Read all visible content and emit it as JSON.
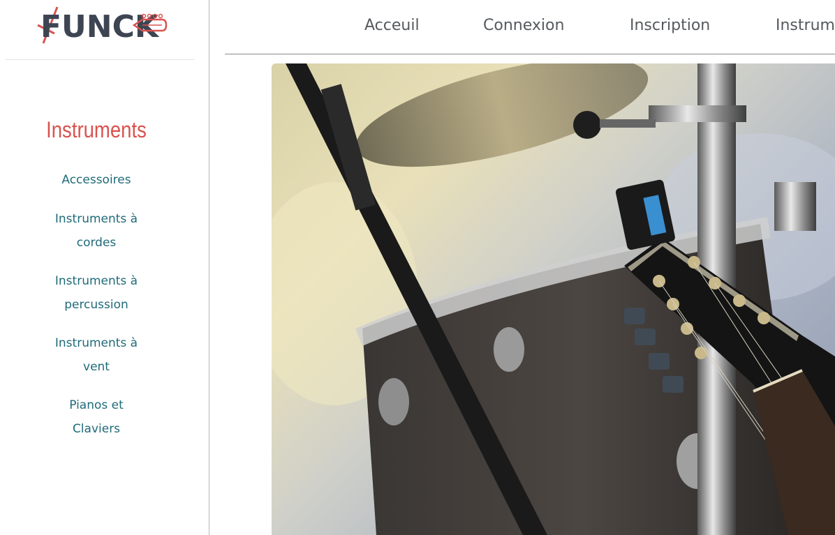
{
  "brand": {
    "logo_text": "FUNCK"
  },
  "sidebar": {
    "title": "Instruments",
    "items": [
      {
        "line1": "Accessoires",
        "line2": ""
      },
      {
        "line1": "Instruments à",
        "line2": "cordes"
      },
      {
        "line1": "Instruments à",
        "line2": "percussion"
      },
      {
        "line1": "Instruments à",
        "line2": "vent"
      },
      {
        "line1": "Pianos et",
        "line2": "Claviers"
      }
    ]
  },
  "nav": {
    "items": [
      "Acceuil",
      "Connexion",
      "Inscription",
      "Instrum"
    ]
  },
  "colors": {
    "accent": "#d9534f",
    "link": "#1f6b78",
    "nav_text": "#555a5e",
    "logo_text": "#3d4452"
  }
}
